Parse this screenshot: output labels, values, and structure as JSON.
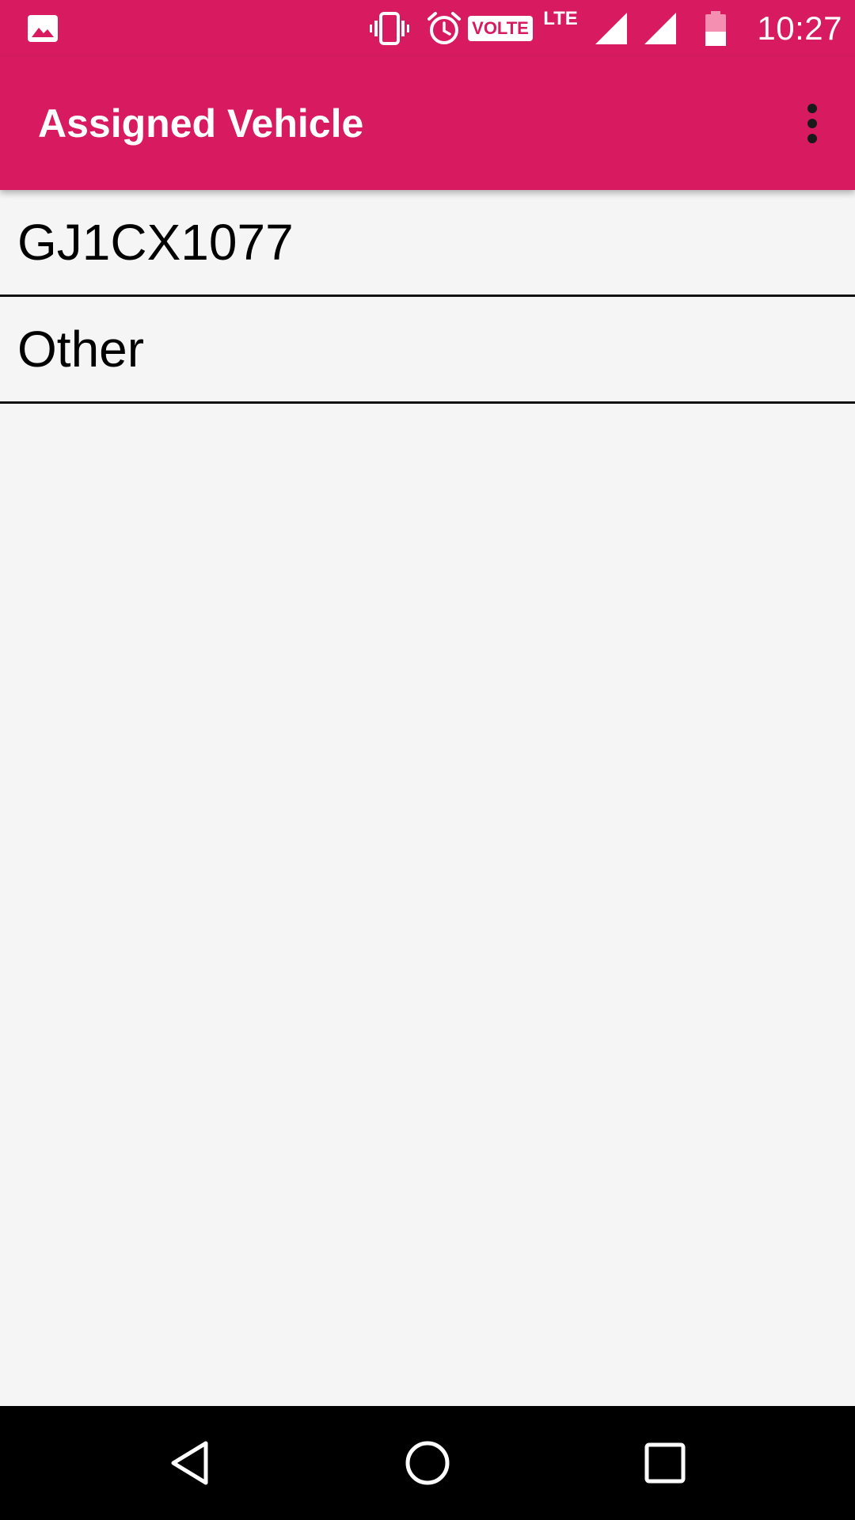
{
  "status_bar": {
    "time": "10:27",
    "volte_label": "VOLTE",
    "network_label": "LTE",
    "icons": [
      "image-notification-icon",
      "vibrate-icon",
      "alarm-icon",
      "volte-icon",
      "lte-icon",
      "signal-icon",
      "signal-icon",
      "battery-icon"
    ]
  },
  "app_bar": {
    "title": "Assigned Vehicle",
    "overflow_icon": "more-vert-icon"
  },
  "vehicles": [
    {
      "label": "GJ1CX1077"
    },
    {
      "label": "Other"
    }
  ],
  "nav_bar": {
    "icons": [
      "back-icon",
      "home-icon",
      "recents-icon"
    ]
  },
  "colors": {
    "primary": "#d81b60",
    "background": "#f5f5f5",
    "nav_background": "#000000",
    "divider": "#111111",
    "battery_level": "#f48fb1"
  }
}
